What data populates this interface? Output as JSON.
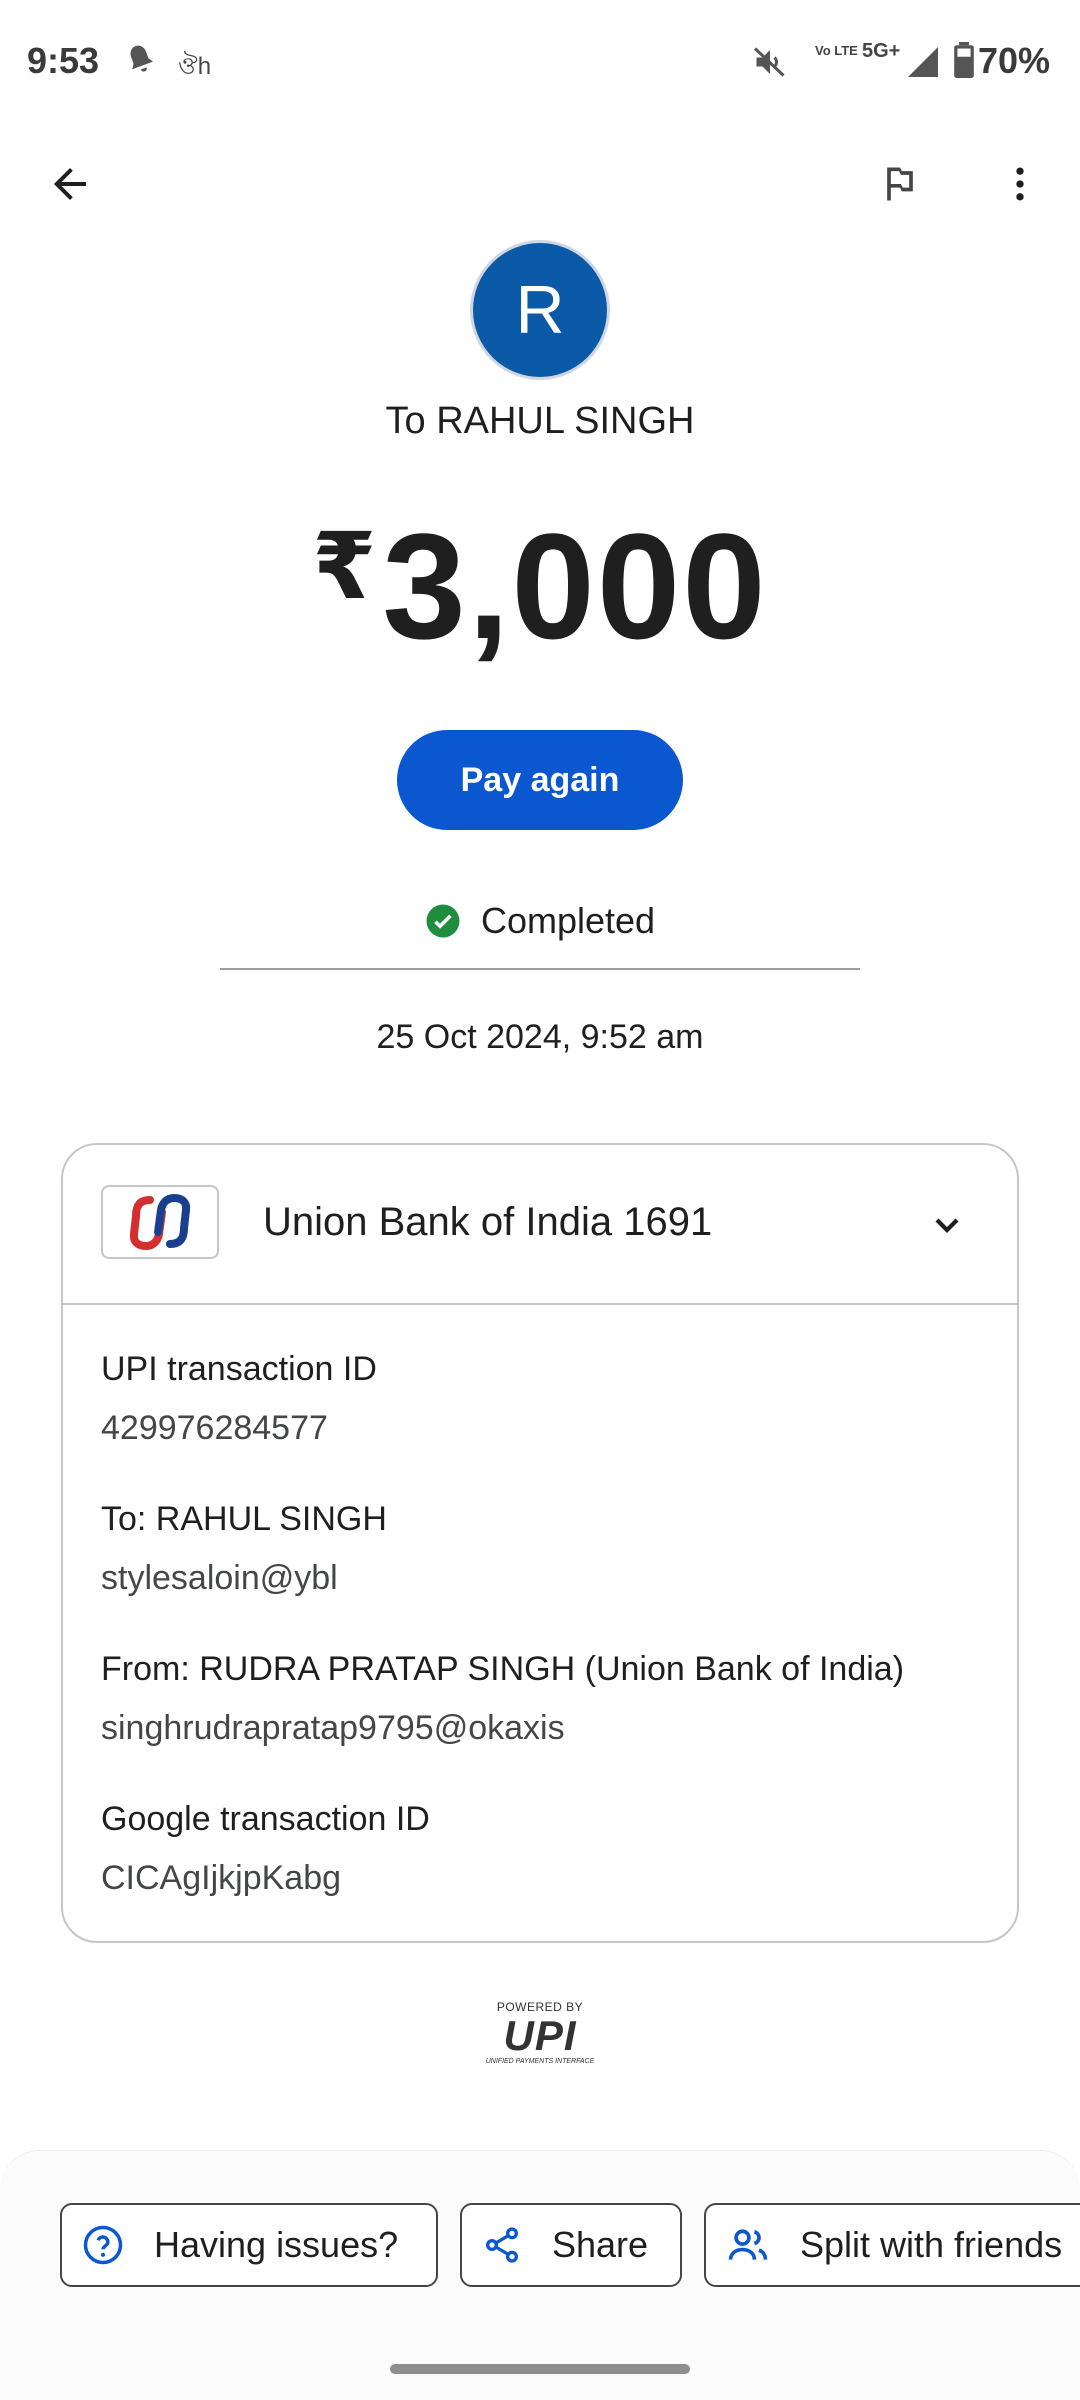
{
  "status_bar": {
    "time": "9:53",
    "dh_label": "ঔh",
    "volte_label": "Vo LTE",
    "network": "5G+",
    "battery": "70%"
  },
  "topbar": {
    "back_icon": "arrow-back-icon",
    "report_icon": "flag-icon",
    "more_icon": "more-vert-icon"
  },
  "recipient": {
    "avatar_letter": "R",
    "title": "To RAHUL SINGH"
  },
  "amount": {
    "currency": "₹",
    "value": "3,000"
  },
  "pay_again_label": "Pay again",
  "status": {
    "label": "Completed",
    "color": "#1e8e3e"
  },
  "timestamp": "25 Oct 2024, 9:52 am",
  "bank": {
    "name": "Union Bank of India 1691"
  },
  "details": [
    {
      "label": "UPI transaction ID",
      "value": "429976284577"
    },
    {
      "label": "To: RAHUL SINGH",
      "value": "stylesaloin@ybl"
    },
    {
      "label": "From: RUDRA PRATAP SINGH (Union Bank of India)",
      "value": "singhrudrapratap9795@okaxis"
    },
    {
      "label": "Google transaction ID",
      "value": "CICAgIjkjpKabg"
    }
  ],
  "upi_logo": {
    "powered_by": "POWERED BY",
    "brand": "UPI",
    "subtitle": "UNIFIED PAYMENTS INTERFACE"
  },
  "actions": {
    "issues": "Having issues?",
    "share": "Share",
    "split": "Split with friends"
  },
  "colors": {
    "accent": "#0b57d0",
    "avatar": "#0b5aa8"
  }
}
